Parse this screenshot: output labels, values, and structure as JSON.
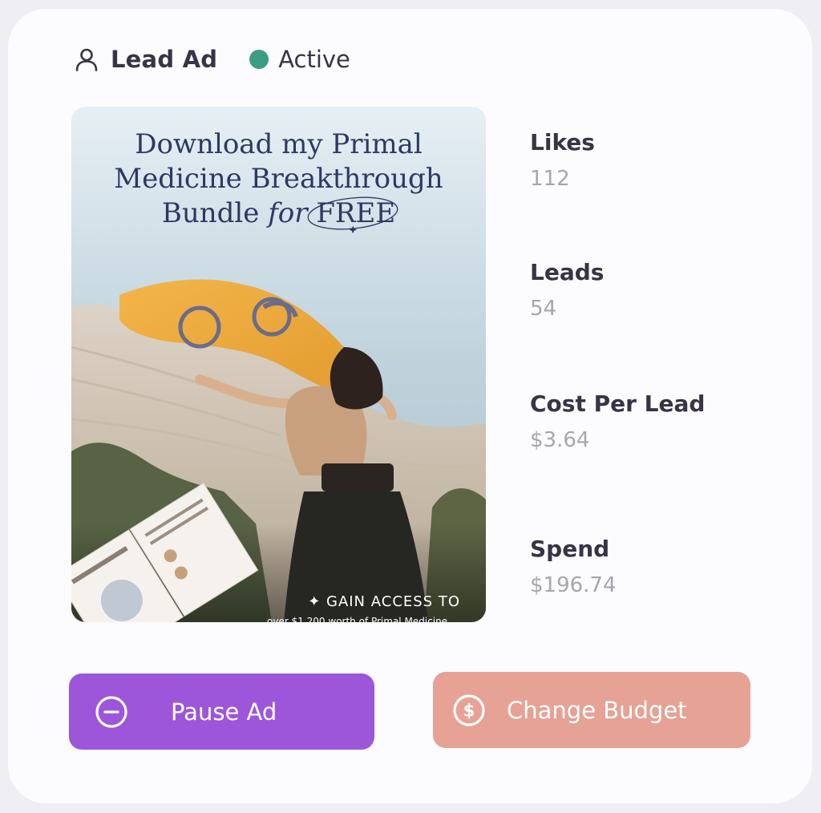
{
  "header": {
    "ad_type": "Lead Ad",
    "status": "Active",
    "status_color": "#3d9c86"
  },
  "ad_creative": {
    "headline_line1": "Download my Primal",
    "headline_line2": "Medicine Breakthrough",
    "headline_line3_pre": "Bundle ",
    "headline_line3_italic": "for",
    "headline_line3_post": "FREE",
    "cta": "✦ GAIN ACCESS TO",
    "sub_cta": "over $1,200 worth of Primal Medicine"
  },
  "stats": [
    {
      "label": "Likes",
      "value": "112"
    },
    {
      "label": "Leads",
      "value": "54"
    },
    {
      "label": "Cost Per Lead",
      "value": "$3.64"
    },
    {
      "label": "Spend",
      "value": "$196.74"
    }
  ],
  "actions": {
    "pause_label": "Pause Ad",
    "pause_color": "#9d56da",
    "budget_label": "Change Budget",
    "budget_color": "#e5a295"
  },
  "icons": {
    "user": "user-icon",
    "status_dot": "status-dot-icon",
    "pause": "minus-circle-icon",
    "budget": "dollar-circle-icon"
  }
}
